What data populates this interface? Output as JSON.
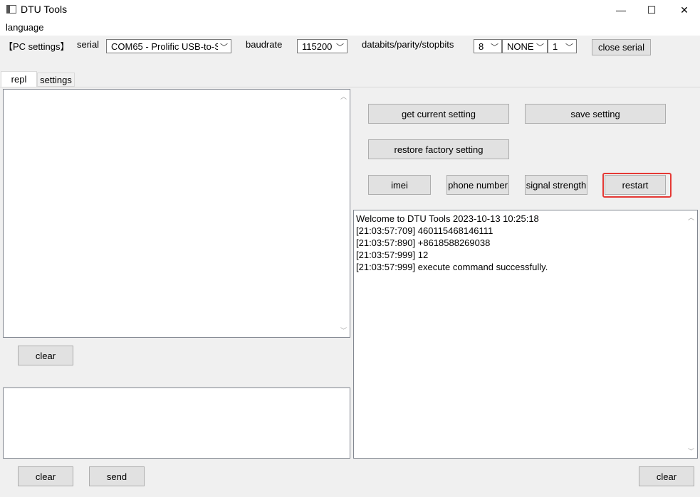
{
  "window": {
    "title": "DTU Tools",
    "minimize_glyph": "—",
    "maximize_glyph": "☐",
    "close_glyph": "✕"
  },
  "menu": {
    "language": "language"
  },
  "pc_settings": {
    "section_label": "【PC settings】",
    "serial_label": "serial",
    "serial_value": "COM65 - Prolific USB-to-S",
    "baudrate_label": "baudrate",
    "baudrate_value": "115200",
    "format_label": "databits/parity/stopbits",
    "databits_value": "8",
    "parity_value": "NONE",
    "stopbits_value": "1",
    "close_serial_label": "close serial"
  },
  "tabs": [
    {
      "label": "repl",
      "active": true
    },
    {
      "label": "settings",
      "active": false
    }
  ],
  "left": {
    "clear_upper_label": "clear",
    "clear_lower_label": "clear",
    "send_label": "send"
  },
  "right": {
    "get_current_setting_label": "get current setting",
    "save_setting_label": "save setting",
    "restore_factory_label": "restore factory setting",
    "imei_label": "imei",
    "phone_number_label": "phone number",
    "signal_strength_label": "signal strength",
    "restart_label": "restart",
    "clear_label": "clear",
    "log_lines": [
      "Welcome to DTU Tools 2023-10-13 10:25:18",
      "[21:03:57:709] 460115468146111",
      "[21:03:57:890] +8618588269038",
      "[21:03:57:999] 12",
      "[21:03:57:999] execute command successfully."
    ]
  },
  "colors": {
    "highlight": "#e53935"
  },
  "icons": {
    "combo_arrow": "chevron-down-icon",
    "scroll_up": "chevron-up-icon",
    "scroll_down": "chevron-down-icon"
  }
}
